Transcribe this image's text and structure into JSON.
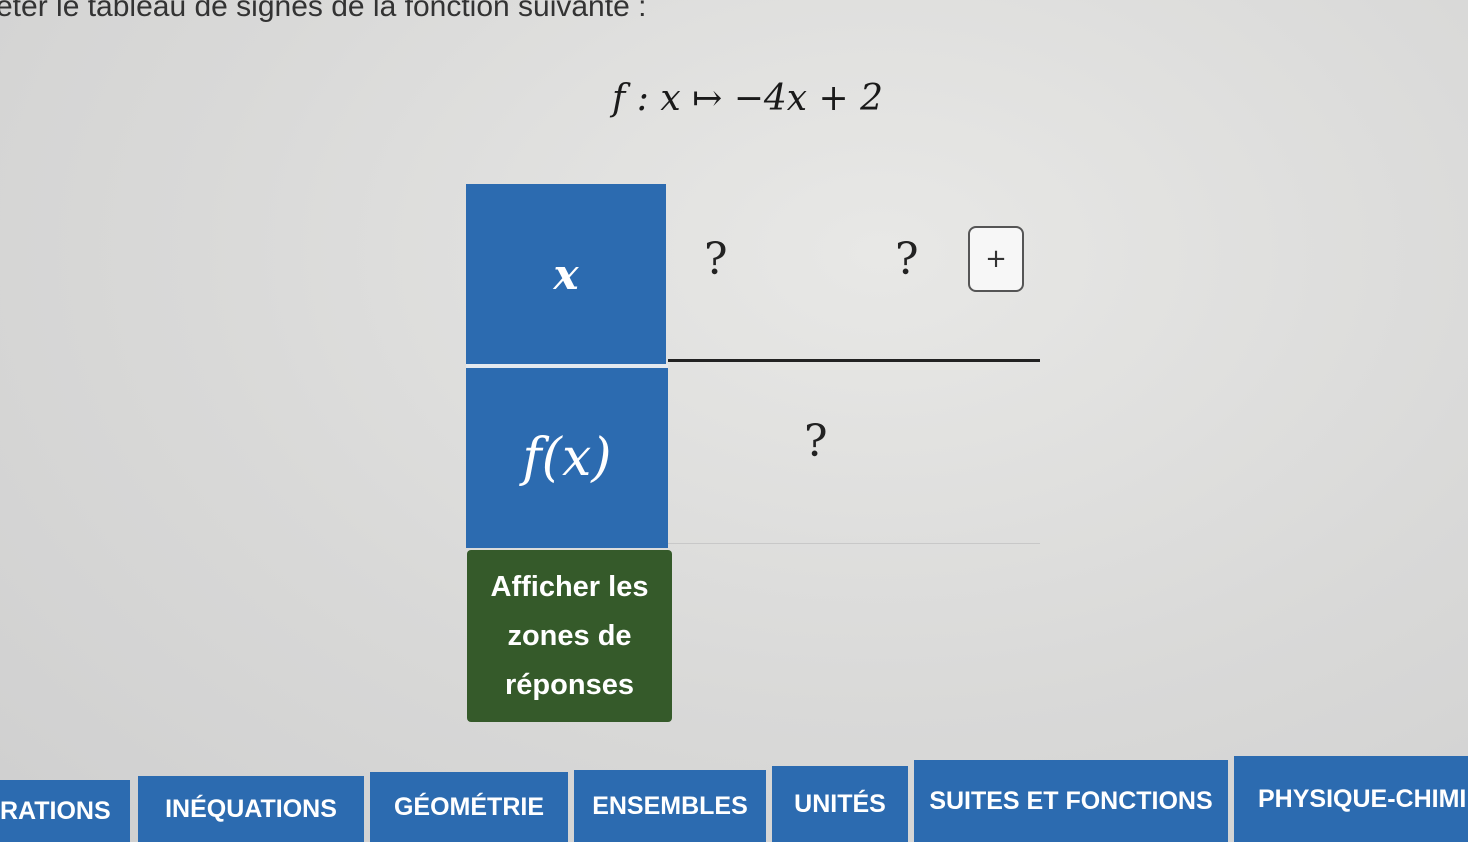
{
  "instruction": "éter le tableau de signes de la fonction suivante :",
  "formula": "f : x ↦ −4x + 2",
  "table": {
    "x_header": "x",
    "fx_header": "f(x)",
    "x_values": [
      "?",
      "?"
    ],
    "sign_value": "?",
    "add_button": "+"
  },
  "show_answers_button": "Afficher les zones de réponses",
  "nav": {
    "items": [
      "RATIONS",
      "INÉQUATIONS",
      "GÉOMÉTRIE",
      "ENSEMBLES",
      "UNITÉS",
      "SUITES ET FONCTIONS",
      "PHYSIQUE-CHIMI"
    ]
  },
  "colors": {
    "header_blue": "#2c6bb0",
    "button_green": "#355a2a",
    "nav_blue": "#2c6bb0"
  }
}
